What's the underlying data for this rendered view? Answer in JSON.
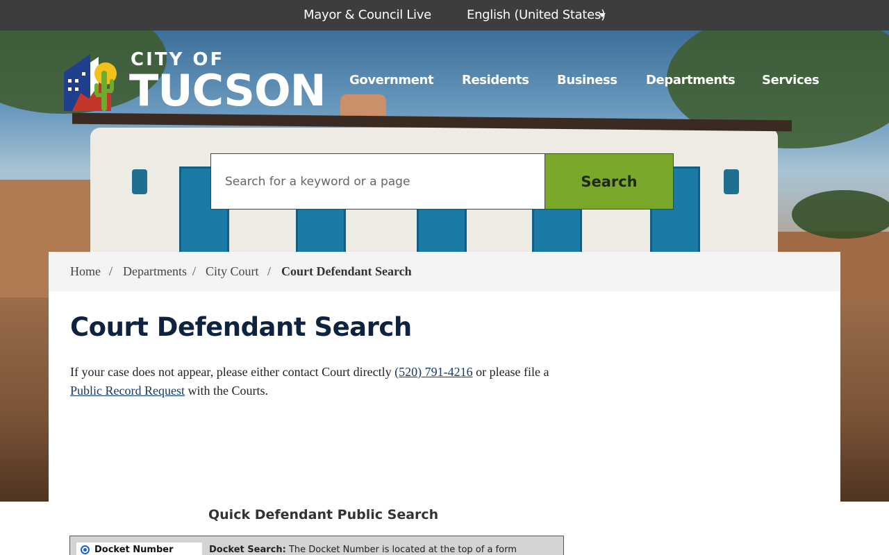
{
  "topbar": {
    "mayor_link": "Mayor & Council Live",
    "language": "English (United States)"
  },
  "logo": {
    "city_of": "CITY OF",
    "name": "TUCSON"
  },
  "nav": {
    "items": [
      "Government",
      "Residents",
      "Business",
      "Departments",
      "Services"
    ]
  },
  "search": {
    "placeholder": "Search for a keyword or a page",
    "button": "Search"
  },
  "breadcrumb": {
    "items": [
      "Home",
      "Departments",
      "City Court",
      "Court Defendant Search"
    ],
    "separator": "/"
  },
  "page": {
    "title": "Court Defendant Search",
    "intro_before_phone": "If your case does not appear, please either contact Court directly ",
    "phone": "(520) 791-4216",
    "intro_after_phone": " or please file a ",
    "record_link": "Public Record Request",
    "intro_end": " with the Courts."
  },
  "quick_search": {
    "title": "Quick Defendant Public Search",
    "radio_label": "Docket Number",
    "help_bold": "Docket Search:",
    "help_text": " The Docket Number is located at the top of a form"
  },
  "colors": {
    "topbar": "#3d3d3d",
    "search_button": "#7aa82a",
    "title": "#0e2340",
    "link": "#123a6e"
  }
}
